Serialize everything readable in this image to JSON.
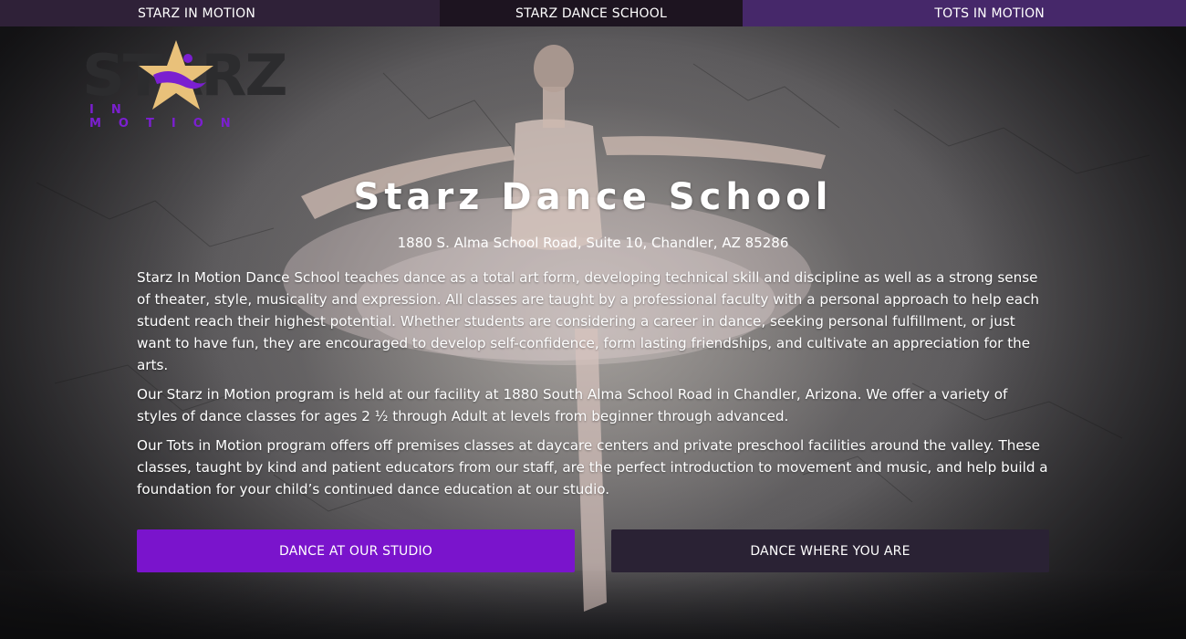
{
  "nav": {
    "items": [
      {
        "label": "STARZ IN MOTION"
      },
      {
        "label": "STARZ DANCE SCHOOL"
      },
      {
        "label": "TOTS IN MOTION"
      }
    ]
  },
  "logo": {
    "wordmark": "STARZ",
    "subtitle": "IN MOTION"
  },
  "hero": {
    "title": "Starz Dance School",
    "address": "1880 S. Alma School Road, Suite 10, Chandler, AZ 85286",
    "paragraphs": [
      "Starz In Motion Dance School teaches dance as a total art form, developing technical skill and discipline as well as a strong sense of theater, style, musicality and expression. All classes are taught by a professional faculty with a personal approach to help each student reach their highest potential. Whether students are considering a career in dance, seeking personal fulfillment, or just want to have fun, they are encouraged to develop self-confidence, form lasting friendships, and cultivate an appreciation for the arts.",
      "Our Starz in Motion program is held at our facility at 1880 South Alma School Road in Chandler, Arizona. We offer a variety of styles of dance classes for ages 2 ½ through Adult at levels from beginner through advanced.",
      "Our Tots in Motion program offers off premises classes at daycare centers and private preschool facilities around the valley. These classes, taught by kind and patient educators from our staff, are the perfect introduction to movement and music, and help build a foundation for your child’s continued dance education at our studio."
    ]
  },
  "buttons": {
    "studio": "DANCE AT OUR STUDIO",
    "where": "DANCE WHERE YOU ARE"
  },
  "colors": {
    "accent": "#7a14cc",
    "nav_dark": "#1d1420",
    "nav_mid": "#2f2138",
    "nav_purple": "#46286a",
    "star_gold": "#e9c17a"
  }
}
